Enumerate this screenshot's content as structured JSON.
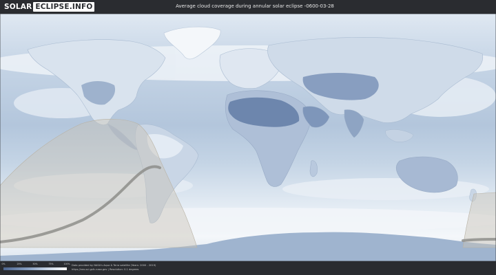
{
  "header": {
    "logo_solar": "SOLAR",
    "logo_rest": "ECLIPSE.INFO",
    "title": "Average cloud coverage during annular solar eclipse -0600-03-28"
  },
  "legend": {
    "ticks": [
      "0%",
      "25%",
      "50%",
      "75%",
      "100%"
    ],
    "colors": [
      "#4d6690",
      "#8aa2c4",
      "#c9d6e6",
      "#ffffff"
    ]
  },
  "footer": {
    "credit_line1": "Data provided by NASA's Aqua & Terra satellite (Years: 2000 - 2019)",
    "credit_line2": "https://neo.sci.gsfc.nasa.gov  |  Resolution: 0.1 degrees"
  },
  "map_colors": {
    "ocean": "#b8cadf",
    "land_clear": "#6f87ad",
    "cloud": "#f2f6fa",
    "eclipse_zone": "#c8c2b4",
    "eclipse_path": "#8a8a86"
  }
}
